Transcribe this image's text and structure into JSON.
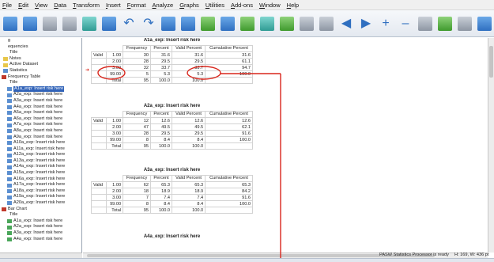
{
  "menu": [
    "File",
    "Edit",
    "View",
    "Data",
    "Transform",
    "Insert",
    "Format",
    "Analyze",
    "Graphs",
    "Utilities",
    "Add-ons",
    "Window",
    "Help"
  ],
  "outline": [
    {
      "label": "g",
      "level": 0,
      "icon": "none"
    },
    {
      "label": "equencies",
      "level": 0,
      "icon": "none"
    },
    {
      "label": "Title",
      "level": 1,
      "icon": "none"
    },
    {
      "label": "Notes",
      "level": 1,
      "icon": "note"
    },
    {
      "label": "Active Dataset",
      "level": 1,
      "icon": "note"
    },
    {
      "label": "Statistics",
      "level": 1,
      "icon": "tbl"
    },
    {
      "label": "Frequency Table",
      "level": 0,
      "icon": "book"
    },
    {
      "label": "Title",
      "level": 1,
      "icon": "none"
    },
    {
      "label": "A1a_exp: Insert risk here",
      "level": 2,
      "icon": "tbl",
      "selected": true
    },
    {
      "label": "A2a_exp: Insert risk here",
      "level": 2,
      "icon": "tbl"
    },
    {
      "label": "A3a_exp: Insert risk here",
      "level": 2,
      "icon": "tbl"
    },
    {
      "label": "A4a_exp: Insert risk here",
      "level": 2,
      "icon": "tbl"
    },
    {
      "label": "A5a_exp: Insert risk here",
      "level": 2,
      "icon": "tbl"
    },
    {
      "label": "A6a_exp: Insert risk here",
      "level": 2,
      "icon": "tbl"
    },
    {
      "label": "A7a_exp: Insert risk here",
      "level": 2,
      "icon": "tbl"
    },
    {
      "label": "A8a_exp: Insert risk here",
      "level": 2,
      "icon": "tbl"
    },
    {
      "label": "A9a_exp: Insert risk here",
      "level": 2,
      "icon": "tbl"
    },
    {
      "label": "A10a_exp: Insert risk here",
      "level": 2,
      "icon": "tbl"
    },
    {
      "label": "A11a_exp: Insert risk here",
      "level": 2,
      "icon": "tbl"
    },
    {
      "label": "A12a_exp: Insert risk here",
      "level": 2,
      "icon": "tbl"
    },
    {
      "label": "A13a_exp: Insert risk here",
      "level": 2,
      "icon": "tbl"
    },
    {
      "label": "A14a_exp: Insert risk here",
      "level": 2,
      "icon": "tbl"
    },
    {
      "label": "A15a_exp: Insert risk here",
      "level": 2,
      "icon": "tbl"
    },
    {
      "label": "A16a_exp: Insert risk here",
      "level": 2,
      "icon": "tbl"
    },
    {
      "label": "A17a_exp: Insert risk here",
      "level": 2,
      "icon": "tbl"
    },
    {
      "label": "A18a_exp: Insert risk here",
      "level": 2,
      "icon": "tbl"
    },
    {
      "label": "A19a_exp: Insert risk here",
      "level": 2,
      "icon": "tbl"
    },
    {
      "label": "A20a_exp: Insert risk here",
      "level": 2,
      "icon": "tbl"
    },
    {
      "label": "Bar Chart",
      "level": 0,
      "icon": "book"
    },
    {
      "label": "Title",
      "level": 1,
      "icon": "none"
    },
    {
      "label": "A1a_exp: Insert risk here",
      "level": 2,
      "icon": "chart"
    },
    {
      "label": "A2a_exp: Insert risk here",
      "level": 2,
      "icon": "chart"
    },
    {
      "label": "A3a_exp: Insert risk here",
      "level": 2,
      "icon": "chart"
    },
    {
      "label": "A4a_exp: Insert risk here",
      "level": 2,
      "icon": "chart"
    }
  ],
  "headers": {
    "frequency": "Frequency",
    "percent": "Percent",
    "valid_percent": "Valid Percent",
    "cumulative_percent": "Cumulative Percent"
  },
  "valid_label": "Valid",
  "tables": [
    {
      "title": "A1a_exp: Insert risk here",
      "rows": [
        [
          "1.00",
          "30",
          "31.6",
          "31.6",
          "31.6"
        ],
        [
          "2.00",
          "28",
          "29.5",
          "29.5",
          "61.1"
        ],
        [
          "3.00",
          "32",
          "33.7",
          "33.7",
          "94.7"
        ],
        [
          "99.00",
          "5",
          "5.3",
          "5.3",
          "100.0"
        ],
        [
          "Total",
          "95",
          "100.0",
          "100.0",
          ""
        ]
      ]
    },
    {
      "title": "A2a_exp: Insert risk here",
      "rows": [
        [
          "1.00",
          "12",
          "12.6",
          "12.6",
          "12.6"
        ],
        [
          "2.00",
          "47",
          "49.5",
          "49.5",
          "62.1"
        ],
        [
          "3.00",
          "28",
          "29.5",
          "29.5",
          "91.6"
        ],
        [
          "99.00",
          "8",
          "8.4",
          "8.4",
          "100.0"
        ],
        [
          "Total",
          "95",
          "100.0",
          "100.0",
          ""
        ]
      ]
    },
    {
      "title": "A3a_exp: Insert risk here",
      "rows": [
        [
          "1.00",
          "62",
          "65.3",
          "65.3",
          "65.3"
        ],
        [
          "2.00",
          "18",
          "18.9",
          "18.9",
          "84.2"
        ],
        [
          "3.00",
          "7",
          "7.4",
          "7.4",
          "91.6"
        ],
        [
          "99.00",
          "8",
          "8.4",
          "8.4",
          "100.0"
        ],
        [
          "Total",
          "95",
          "100.0",
          "100.0",
          ""
        ]
      ]
    },
    {
      "title": "A4a_exp: Insert risk here",
      "rows": []
    }
  ],
  "status": {
    "processor": "PASW Statistics Processor is ready",
    "dims": "H: 169, W: 436 pt"
  },
  "annotation_color": "#d9261c",
  "selection_color": "#3163b8"
}
